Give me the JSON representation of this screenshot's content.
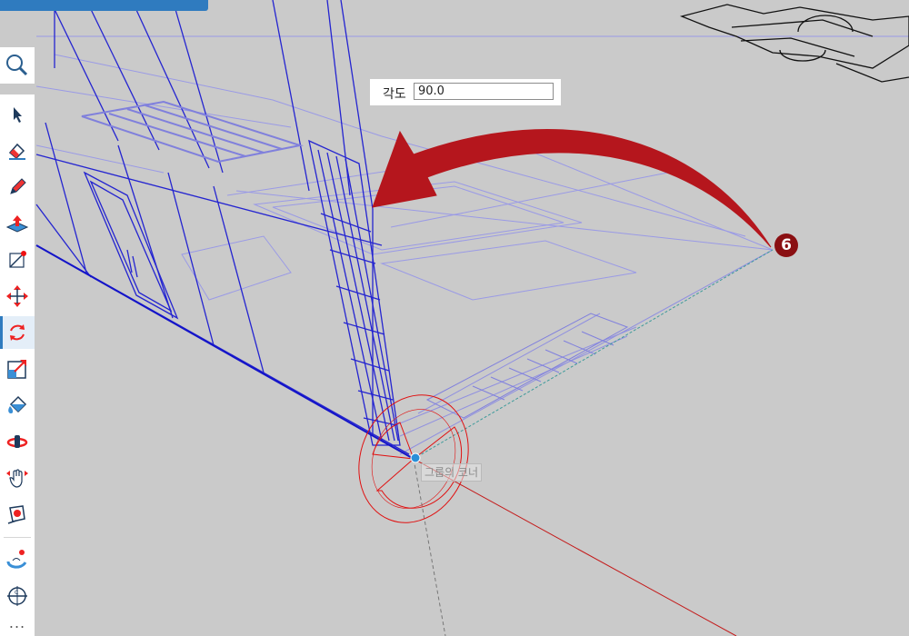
{
  "angle_input": {
    "label": "각도",
    "value": "90.0"
  },
  "snap_tooltip": "그룹의 코너",
  "step_badge": "6",
  "more_label": "...",
  "colors": {
    "viewport_bg": "#cacaca",
    "toolbar_bg": "#ffffff",
    "accent": "#2f7bbf",
    "wireframe": "#2a2ad0",
    "wireframe_faint": "#8c8ce0",
    "protractor": "#e01010",
    "arrow": "#b5161d",
    "axis_red": "#c41a1a",
    "axis_green": "#3d9a9a"
  },
  "tools": [
    {
      "name": "select-tool",
      "icon": "cursor-arrow-icon"
    },
    {
      "name": "eraser-tool",
      "icon": "eraser-icon"
    },
    {
      "name": "pencil-tool",
      "icon": "pencil-icon"
    },
    {
      "name": "push-pull-tool",
      "icon": "push-pull-icon"
    },
    {
      "name": "line-tool",
      "icon": "line-endpoint-icon"
    },
    {
      "name": "move-tool",
      "icon": "move-arrows-icon"
    },
    {
      "name": "rotate-tool",
      "icon": "rotate-icon",
      "active": true
    },
    {
      "name": "scale-tool",
      "icon": "scale-icon"
    },
    {
      "name": "paint-bucket-tool",
      "icon": "paint-bucket-icon"
    },
    {
      "name": "orbit-tool",
      "icon": "orbit-icon"
    },
    {
      "name": "pan-tool",
      "icon": "pan-hand-icon"
    },
    {
      "name": "tape-measure-tool",
      "icon": "tape-measure-icon"
    },
    {
      "name": "follow-me-tool",
      "icon": "follow-me-icon"
    },
    {
      "name": "protractor-tool",
      "icon": "protractor-icon"
    }
  ]
}
